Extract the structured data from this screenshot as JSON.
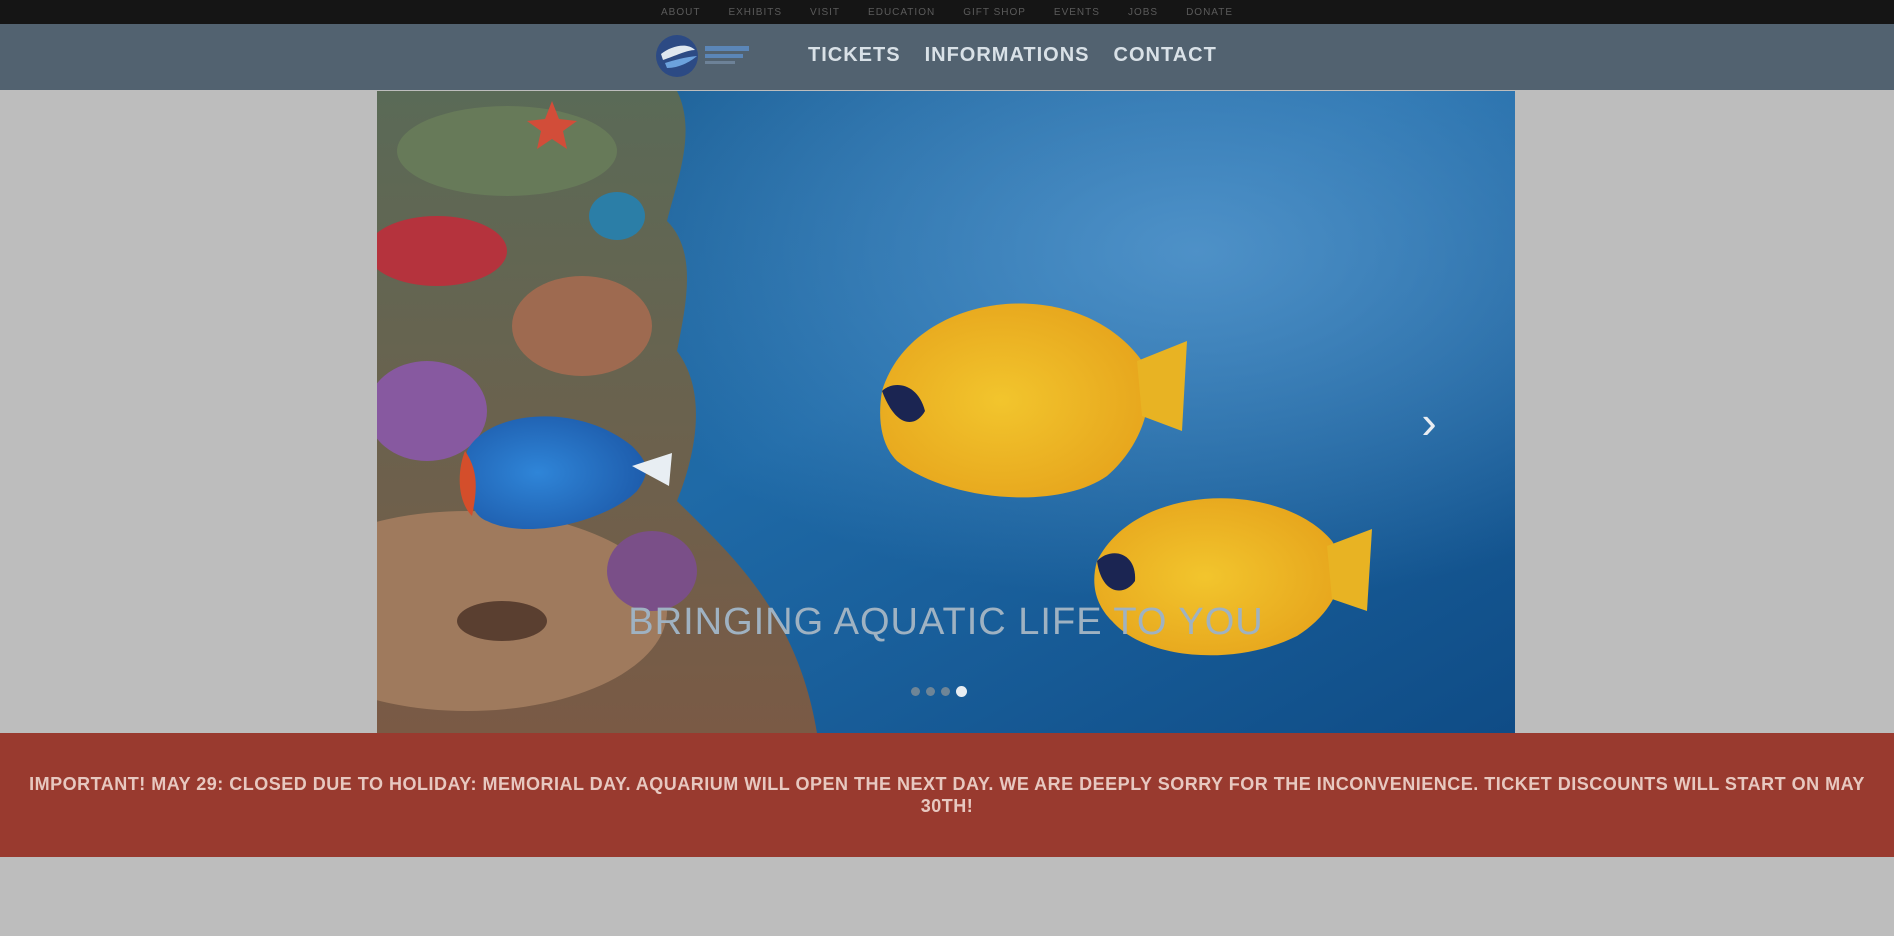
{
  "topbar": {
    "links": [
      "About",
      "Exhibits",
      "Visit",
      "Education",
      "Gift Shop",
      "Events",
      "Jobs",
      "Donate"
    ]
  },
  "navbar": {
    "logo_alt": "Aquarium logo",
    "links": [
      "TICKETS",
      "INFORMATIONS",
      "CONTACT"
    ]
  },
  "hero": {
    "caption": "BRINGING AQUATIC LIFE TO YOU",
    "dots": 4,
    "active_dot": 4
  },
  "alert": {
    "text": "IMPORTANT! MAY 29: CLOSED DUE TO HOLIDAY: MEMORIAL DAY. AQUARIUM WILL OPEN THE NEXT DAY. WE ARE DEEPLY SORRY FOR THE INCONVENIENCE. TICKET DISCOUNTS WILL START ON MAY 30TH!"
  },
  "colors": {
    "topbar": "#151515",
    "navbar": "#526270",
    "alert": "#993a2f",
    "page_bg": "#bdbdbd"
  }
}
